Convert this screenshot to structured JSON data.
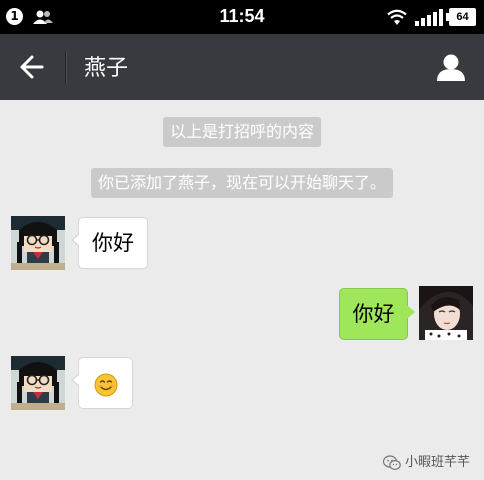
{
  "status_bar": {
    "notification_count": "1",
    "time": "11:54",
    "battery": "64",
    "icons": [
      "notification-badge-icon",
      "people-icon",
      "wifi-icon",
      "signal-icon",
      "battery-icon"
    ]
  },
  "header": {
    "title": "燕子",
    "icons": [
      "back-arrow-icon",
      "profile-icon"
    ]
  },
  "chat": {
    "system_messages": [
      "以上是打招呼的内容",
      "你已添加了燕子，现在可以开始聊天了。"
    ],
    "messages": [
      {
        "sender": "contact",
        "text": "你好"
      },
      {
        "sender": "self",
        "text": "你好"
      },
      {
        "sender": "contact",
        "emoji": "smile-emoji-icon"
      }
    ]
  },
  "watermark": {
    "text": "小暇班芊芊",
    "icon": "wechat-icon"
  },
  "colors": {
    "header_bg": "#393a3f",
    "chat_bg": "#ebebeb",
    "self_bubble": "#9fe65a",
    "system_pill": "#cacaca"
  }
}
